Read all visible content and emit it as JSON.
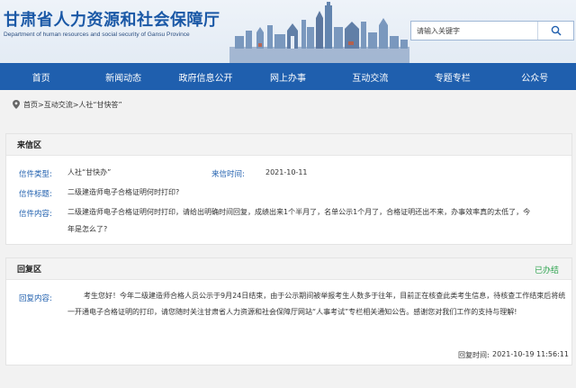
{
  "header": {
    "title": "甘肃省人力资源和社会保障厅",
    "subtitle": "Department of human resources and social security of Gansu Province",
    "search_placeholder": "请输入关键字"
  },
  "nav": {
    "items": [
      "首页",
      "新闻动态",
      "政府信息公开",
      "网上办事",
      "互动交流",
      "专题专栏",
      "公众号"
    ]
  },
  "breadcrumb": {
    "home": "首页",
    "section": "互动交流",
    "current": "人社“甘快答”",
    "separator": ">"
  },
  "letter": {
    "section_title": "来信区",
    "type_label": "信件类型:",
    "type_value": "人社“甘快办”",
    "time_label": "来信时间:",
    "time_value": "2021-10-11",
    "title_label": "信件标题:",
    "title_value": "二级建造师电子合格证明何时打印?",
    "content_label": "信件内容:",
    "content_line1": "二级建造师电子合格证明何时打印，请给出明确时间回复，成绩出来1个半月了，名单公示1个月了，合格证明还出不来，办事效率真的太低了，今",
    "content_line2": "年是怎么了?"
  },
  "reply": {
    "section_title": "回复区",
    "status": "已办结",
    "content_label": "回复内容:",
    "content": "考生您好！今年二级建造师合格人员公示于9月24日结束，由于公示期间被举报考生人数多于往年，目前正在核查此类考生信息，待核查工作结束后将统一开通电子合格证明的打印，请您随时关注甘肃省人力资源和社会保障厅网站“人事考试”专栏相关通知公告。感谢您对我们工作的支持与理解!",
    "time_label": "回复时间:",
    "time_value": "2021-10-19 11:56:11"
  },
  "colors": {
    "brand_blue": "#1f5fae",
    "status_green": "#2ea44f"
  }
}
